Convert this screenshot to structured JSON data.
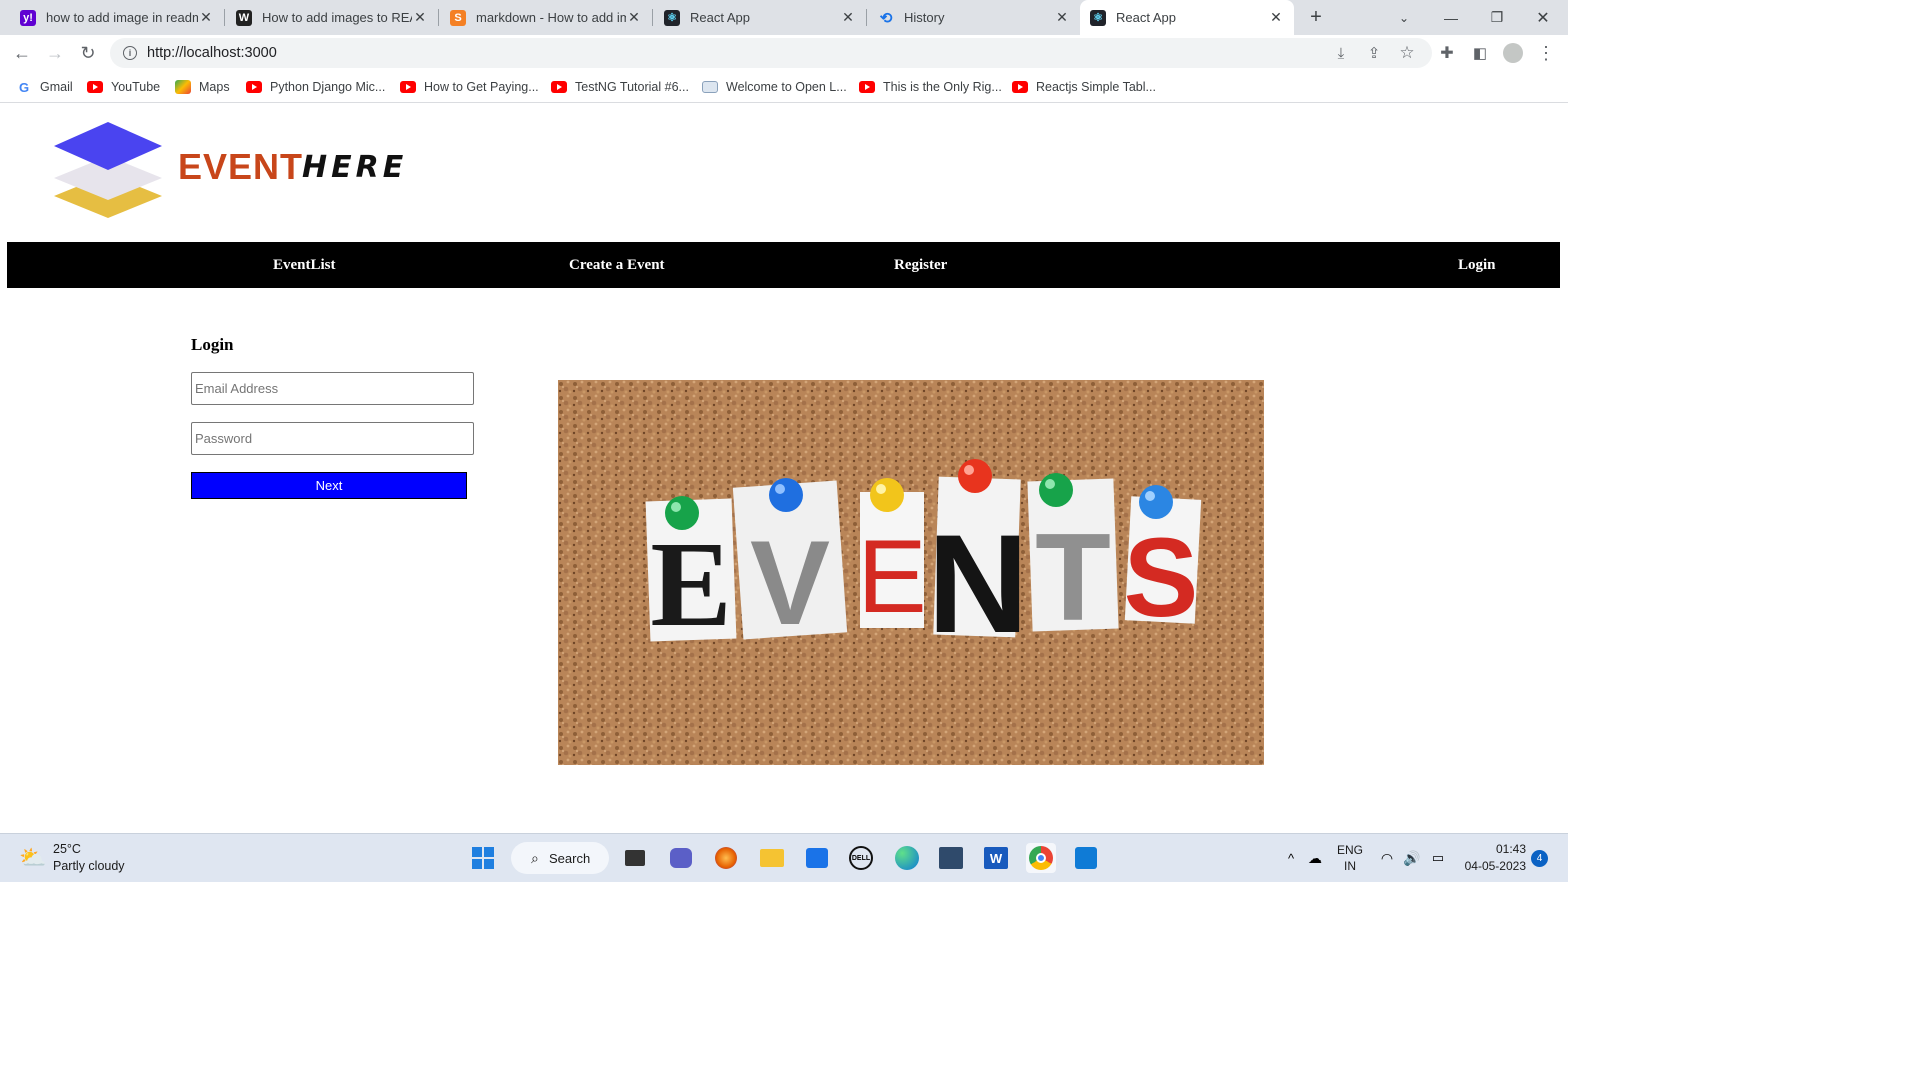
{
  "browser": {
    "tabs": [
      {
        "title": "how to add image in readm",
        "favicon": "yahoo-icon",
        "color": "#6001d2"
      },
      {
        "title": "How to add images to REA",
        "favicon": "w-icon",
        "color": "#222222"
      },
      {
        "title": "markdown - How to add im",
        "favicon": "stackoverflow-icon",
        "color": "#f48024"
      },
      {
        "title": "React App",
        "favicon": "react-icon",
        "color": "#20232a"
      },
      {
        "title": "History",
        "favicon": "history-icon",
        "color": "#1a73e8"
      },
      {
        "title": "React App",
        "favicon": "react-icon",
        "color": "#20232a"
      }
    ],
    "active_tab": 5,
    "url": "http://localhost:3000",
    "bookmarks": [
      {
        "label": "Gmail",
        "icon": "google-icon"
      },
      {
        "label": "YouTube",
        "icon": "youtube-icon"
      },
      {
        "label": "Maps",
        "icon": "maps-icon"
      },
      {
        "label": "Python Django Mic...",
        "icon": "youtube-icon"
      },
      {
        "label": "How to Get Paying...",
        "icon": "youtube-icon"
      },
      {
        "label": "TestNG Tutorial #6...",
        "icon": "youtube-icon"
      },
      {
        "label": "Welcome to Open L...",
        "icon": "page-icon"
      },
      {
        "label": "This is the Only Rig...",
        "icon": "youtube-icon"
      },
      {
        "label": "Reactjs Simple Tabl...",
        "icon": "youtube-icon"
      }
    ]
  },
  "site": {
    "logo": {
      "text1": "EVENT",
      "text2": "HERE"
    },
    "nav": {
      "eventlist": "EventList",
      "create": "Create a Event",
      "register": "Register",
      "login": "Login"
    },
    "login_form": {
      "title": "Login",
      "email_placeholder": "Email Address",
      "password_placeholder": "Password",
      "next_label": "Next",
      "button_color": "#0000ff"
    },
    "banner": {
      "letters": [
        "E",
        "V",
        "E",
        "N",
        "T",
        "S"
      ]
    }
  },
  "taskbar": {
    "weather_temp": "25°C",
    "weather_desc": "Partly cloudy",
    "search_label": "Search",
    "lang_top": "ENG",
    "lang_bottom": "IN",
    "time": "01:43",
    "date": "04-05-2023",
    "notifications": "4"
  }
}
